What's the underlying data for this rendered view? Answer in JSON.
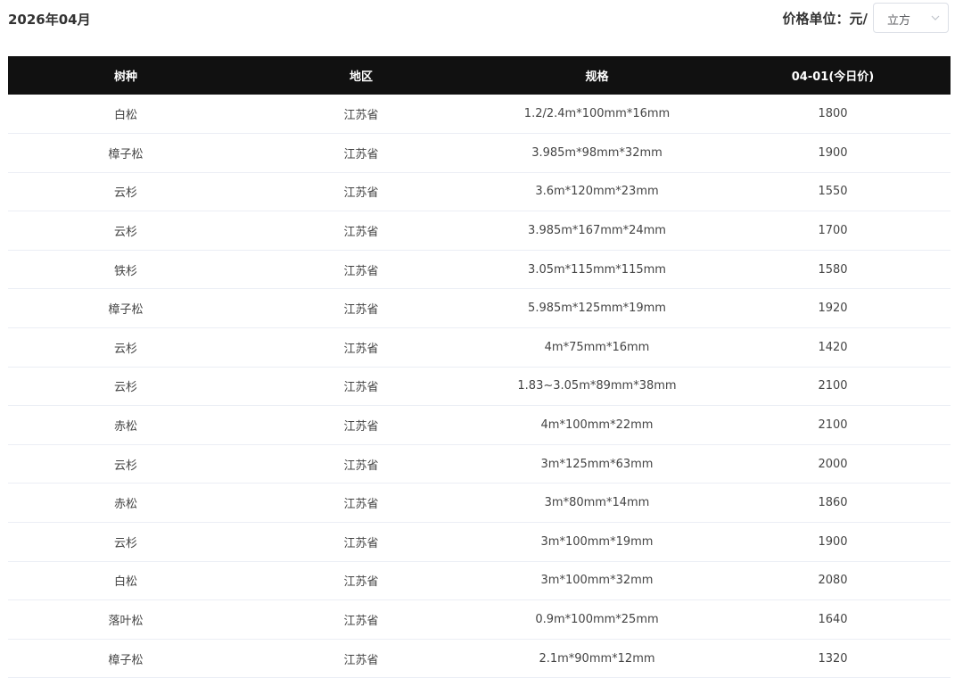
{
  "header": {
    "title": "2026年04月",
    "unit_label": "价格单位：元/",
    "unit_select_value": "立方"
  },
  "table": {
    "columns": [
      "树种",
      "地区",
      "规格",
      "04-01(今日价)"
    ],
    "rows": [
      [
        "白松",
        "江苏省",
        "1.2/2.4m*100mm*16mm",
        "1800"
      ],
      [
        "樟子松",
        "江苏省",
        "3.985m*98mm*32mm",
        "1900"
      ],
      [
        "云杉",
        "江苏省",
        "3.6m*120mm*23mm",
        "1550"
      ],
      [
        "云杉",
        "江苏省",
        "3.985m*167mm*24mm",
        "1700"
      ],
      [
        "铁杉",
        "江苏省",
        "3.05m*115mm*115mm",
        "1580"
      ],
      [
        "樟子松",
        "江苏省",
        "5.985m*125mm*19mm",
        "1920"
      ],
      [
        "云杉",
        "江苏省",
        "4m*75mm*16mm",
        "1420"
      ],
      [
        "云杉",
        "江苏省",
        "1.83~3.05m*89mm*38mm",
        "2100"
      ],
      [
        "赤松",
        "江苏省",
        "4m*100mm*22mm",
        "2100"
      ],
      [
        "云杉",
        "江苏省",
        "3m*125mm*63mm",
        "2000"
      ],
      [
        "赤松",
        "江苏省",
        "3m*80mm*14mm",
        "1860"
      ],
      [
        "云杉",
        "江苏省",
        "3m*100mm*19mm",
        "1900"
      ],
      [
        "白松",
        "江苏省",
        "3m*100mm*32mm",
        "2080"
      ],
      [
        "落叶松",
        "江苏省",
        "0.9m*100mm*25mm",
        "1640"
      ],
      [
        "樟子松",
        "江苏省",
        "2.1m*90mm*12mm",
        "1320"
      ]
    ]
  },
  "colors": {
    "header_bg": "#111111",
    "header_text": "#ffffff",
    "body_text": "#444444",
    "row_divider": "#ebeef5"
  }
}
